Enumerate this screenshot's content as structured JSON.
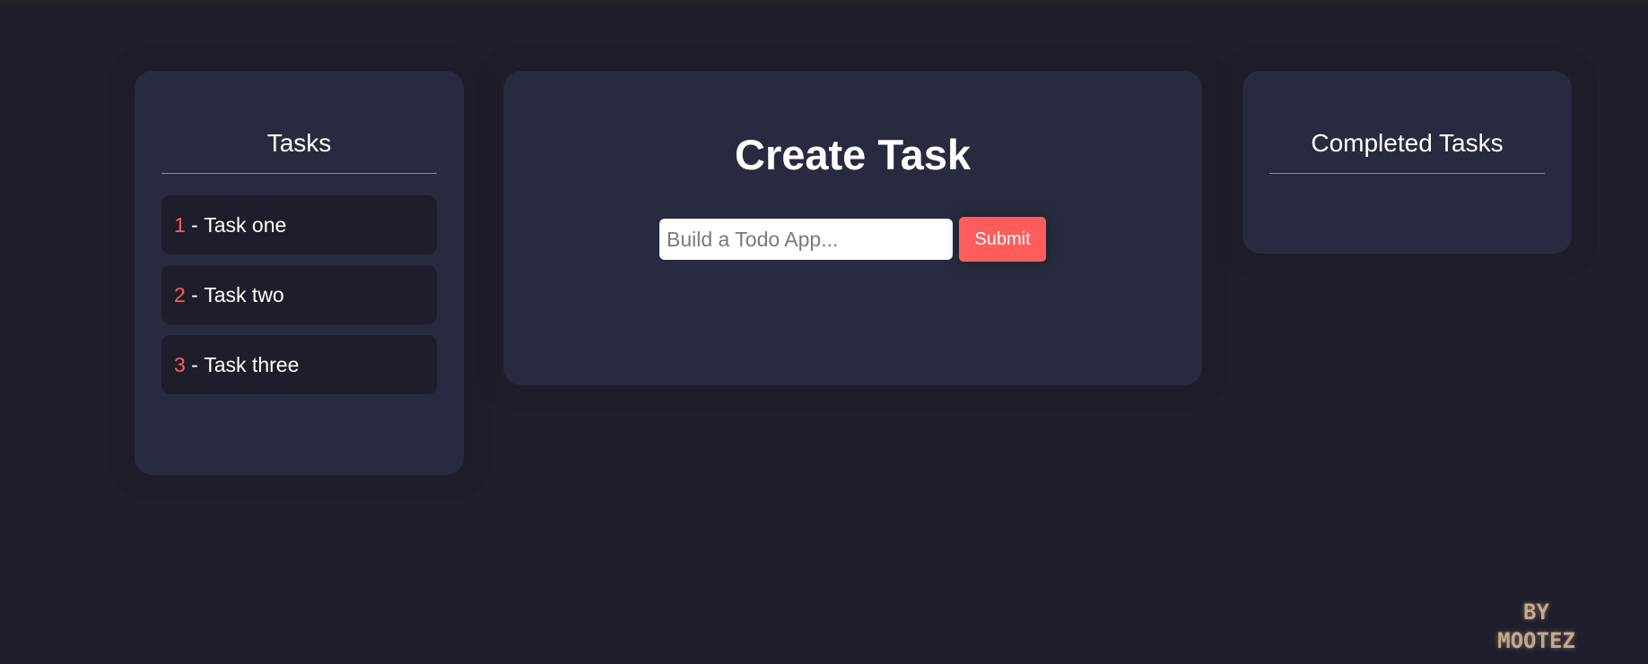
{
  "tasks_panel": {
    "title": "Tasks",
    "separator": " - ",
    "items": [
      {
        "number": "1",
        "label": "Task one"
      },
      {
        "number": "2",
        "label": "Task two"
      },
      {
        "number": "3",
        "label": "Task three"
      }
    ]
  },
  "create_panel": {
    "title": "Create Task",
    "input": {
      "placeholder": "Build a Todo App...",
      "value": ""
    },
    "submit_label": "Submit"
  },
  "completed_panel": {
    "title": "Completed Tasks",
    "items": []
  },
  "credit": {
    "line1": "BY",
    "line2": "MOOTEZ"
  },
  "colors": {
    "background": "#1f1e2d",
    "panel": "#282a3f",
    "task_item": "#1e1d2c",
    "accent": "#ff5c5c",
    "credit": "#c2a98a"
  }
}
